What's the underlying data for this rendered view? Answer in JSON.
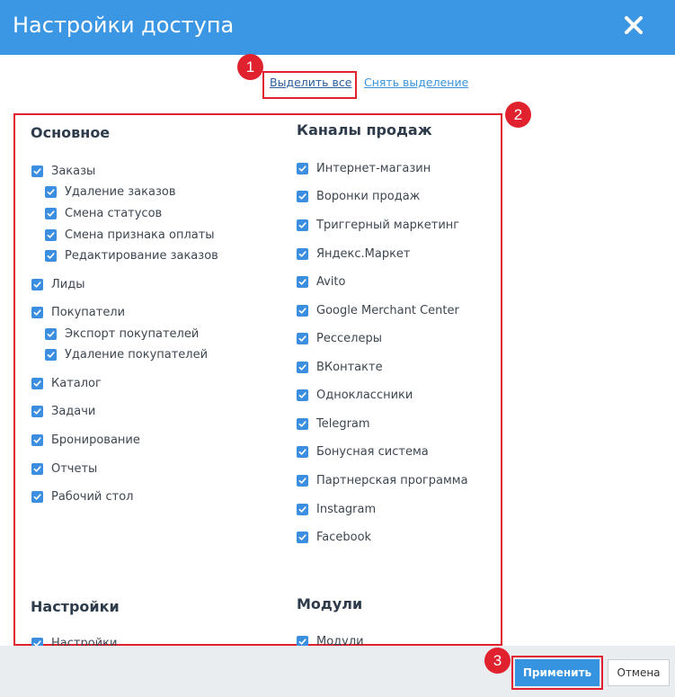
{
  "dialog": {
    "title": "Настройки доступа",
    "close_icon": "close-icon"
  },
  "selection": {
    "select_all": "Выделить все",
    "clear": "Снять выделение"
  },
  "annotations": {
    "marker1": "1",
    "marker2": "2",
    "marker3": "3"
  },
  "sections": {
    "basic": {
      "title": "Основное",
      "items": [
        "Заказы",
        "Удаление заказов",
        "Смена статусов",
        "Смена признака оплаты",
        "Редактирование заказов",
        "Лиды",
        "Покупатели",
        "Экспорт покупателей",
        "Удаление покупателей",
        "Каталог",
        "Задачи",
        "Бронирование",
        "Отчеты",
        "Рабочий стол"
      ]
    },
    "channels": {
      "title": "Каналы продаж",
      "items": [
        "Интернет-магазин",
        "Воронки продаж",
        "Триггерный маркетинг",
        "Яндекс.Маркет",
        "Avito",
        "Google Merchant Center",
        "Ресселеры",
        "ВКонтакте",
        "Одноклассники",
        "Telegram",
        "Бонусная система",
        "Партнерская программа",
        "Instagram",
        "Facebook"
      ]
    },
    "settings": {
      "title": "Настройки",
      "items": [
        "Настройки"
      ]
    },
    "modules": {
      "title": "Модули",
      "items": [
        "Модули"
      ]
    }
  },
  "footer": {
    "apply": "Применить",
    "cancel": "Отмена"
  },
  "colors": {
    "header": "#3b97e3",
    "checkbox": "#3b8ee0",
    "annotation": "#e0212e",
    "apply_button": "#3593e0"
  }
}
